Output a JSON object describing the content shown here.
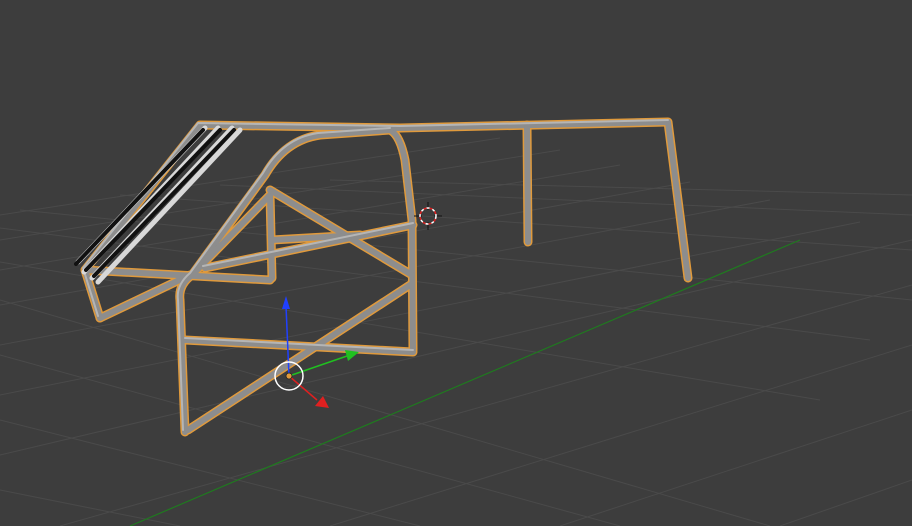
{
  "viewport": {
    "background_color": "#3d3d3d",
    "grid_color": "#4a4a4a",
    "x_axis_color": "#1f7a1f"
  },
  "object": {
    "outline_color": "#e09a3c",
    "tube_color": "#8d8d8d"
  },
  "gizmo": {
    "x_color": "#e02020",
    "y_color": "#20c020",
    "z_color": "#2040ff",
    "origin_color": "#e09a3c",
    "icon": "transform-manipulator-icon"
  },
  "cursor": {
    "icon": "3d-cursor-icon",
    "ring_color_a": "#e02020",
    "ring_color_b": "#ffffff"
  }
}
